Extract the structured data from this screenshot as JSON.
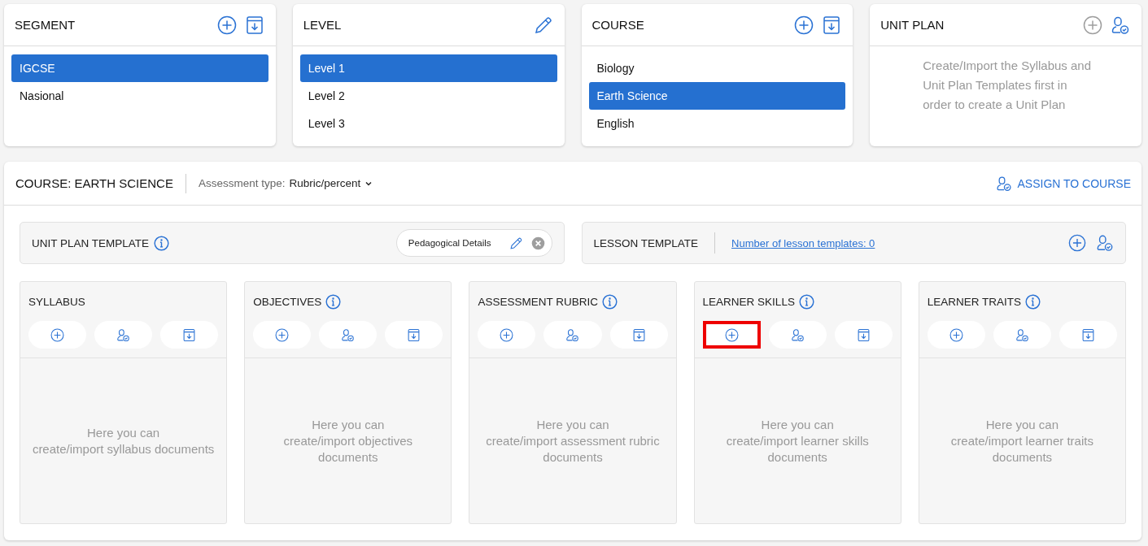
{
  "top_cards": [
    {
      "title": "SEGMENT",
      "actions": [
        {
          "kind": "add",
          "disabled": false
        },
        {
          "kind": "import",
          "disabled": false
        }
      ],
      "items": [
        {
          "label": "IGCSE",
          "selected": true
        },
        {
          "label": "Nasional",
          "selected": false
        }
      ]
    },
    {
      "title": "LEVEL",
      "actions": [
        {
          "kind": "edit",
          "disabled": false
        }
      ],
      "items": [
        {
          "label": "Level 1",
          "selected": true
        },
        {
          "label": "Level 2",
          "selected": false
        },
        {
          "label": "Level 3",
          "selected": false
        }
      ]
    },
    {
      "title": "COURSE",
      "actions": [
        {
          "kind": "add",
          "disabled": false
        },
        {
          "kind": "import",
          "disabled": false
        }
      ],
      "items": [
        {
          "label": "Biology",
          "selected": false
        },
        {
          "label": "Earth Science",
          "selected": true
        },
        {
          "label": "English",
          "selected": false
        }
      ]
    },
    {
      "title": "UNIT PLAN",
      "actions": [
        {
          "kind": "add",
          "disabled": true
        },
        {
          "kind": "assign",
          "disabled": false
        }
      ],
      "message": "Create/Import the Syllabus and Unit Plan Templates first in order to create a Unit Plan"
    }
  ],
  "course_panel": {
    "title": "COURSE: EARTH SCIENCE",
    "assessment_label": "Assessment type:",
    "assessment_value": "Rubric/percent",
    "assign_button": "ASSIGN TO COURSE",
    "unit_plan_template": {
      "title": "UNIT PLAN TEMPLATE",
      "chip": "Pedagogical Details"
    },
    "lesson_template": {
      "title": "LESSON TEMPLATE",
      "link": "Number of lesson templates: 0"
    },
    "documents": [
      {
        "title": "SYLLABUS",
        "info": false,
        "actions": [
          {
            "kind": "add",
            "highlighted": false
          },
          {
            "kind": "assign",
            "highlighted": false
          },
          {
            "kind": "import",
            "highlighted": false
          }
        ],
        "empty_text": "Here you can\ncreate/import syllabus documents"
      },
      {
        "title": "OBJECTIVES",
        "info": true,
        "actions": [
          {
            "kind": "add",
            "highlighted": false
          },
          {
            "kind": "assign",
            "highlighted": false
          },
          {
            "kind": "import",
            "highlighted": false
          }
        ],
        "empty_text": "Here you can\ncreate/import objectives documents"
      },
      {
        "title": "ASSESSMENT RUBRIC",
        "info": true,
        "actions": [
          {
            "kind": "add",
            "highlighted": false
          },
          {
            "kind": "assign",
            "highlighted": false
          },
          {
            "kind": "import",
            "highlighted": false
          }
        ],
        "empty_text": "Here you can\ncreate/import assessment rubric documents"
      },
      {
        "title": "LEARNER SKILLS",
        "info": true,
        "actions": [
          {
            "kind": "add",
            "highlighted": true
          },
          {
            "kind": "assign",
            "highlighted": false
          },
          {
            "kind": "import",
            "highlighted": false
          }
        ],
        "empty_text": "Here you can\ncreate/import learner skills documents"
      },
      {
        "title": "LEARNER TRAITS",
        "info": true,
        "actions": [
          {
            "kind": "add",
            "highlighted": false
          },
          {
            "kind": "assign",
            "highlighted": false
          },
          {
            "kind": "import",
            "highlighted": false
          }
        ],
        "empty_text": "Here you can\ncreate/import learner traits documents"
      }
    ]
  }
}
